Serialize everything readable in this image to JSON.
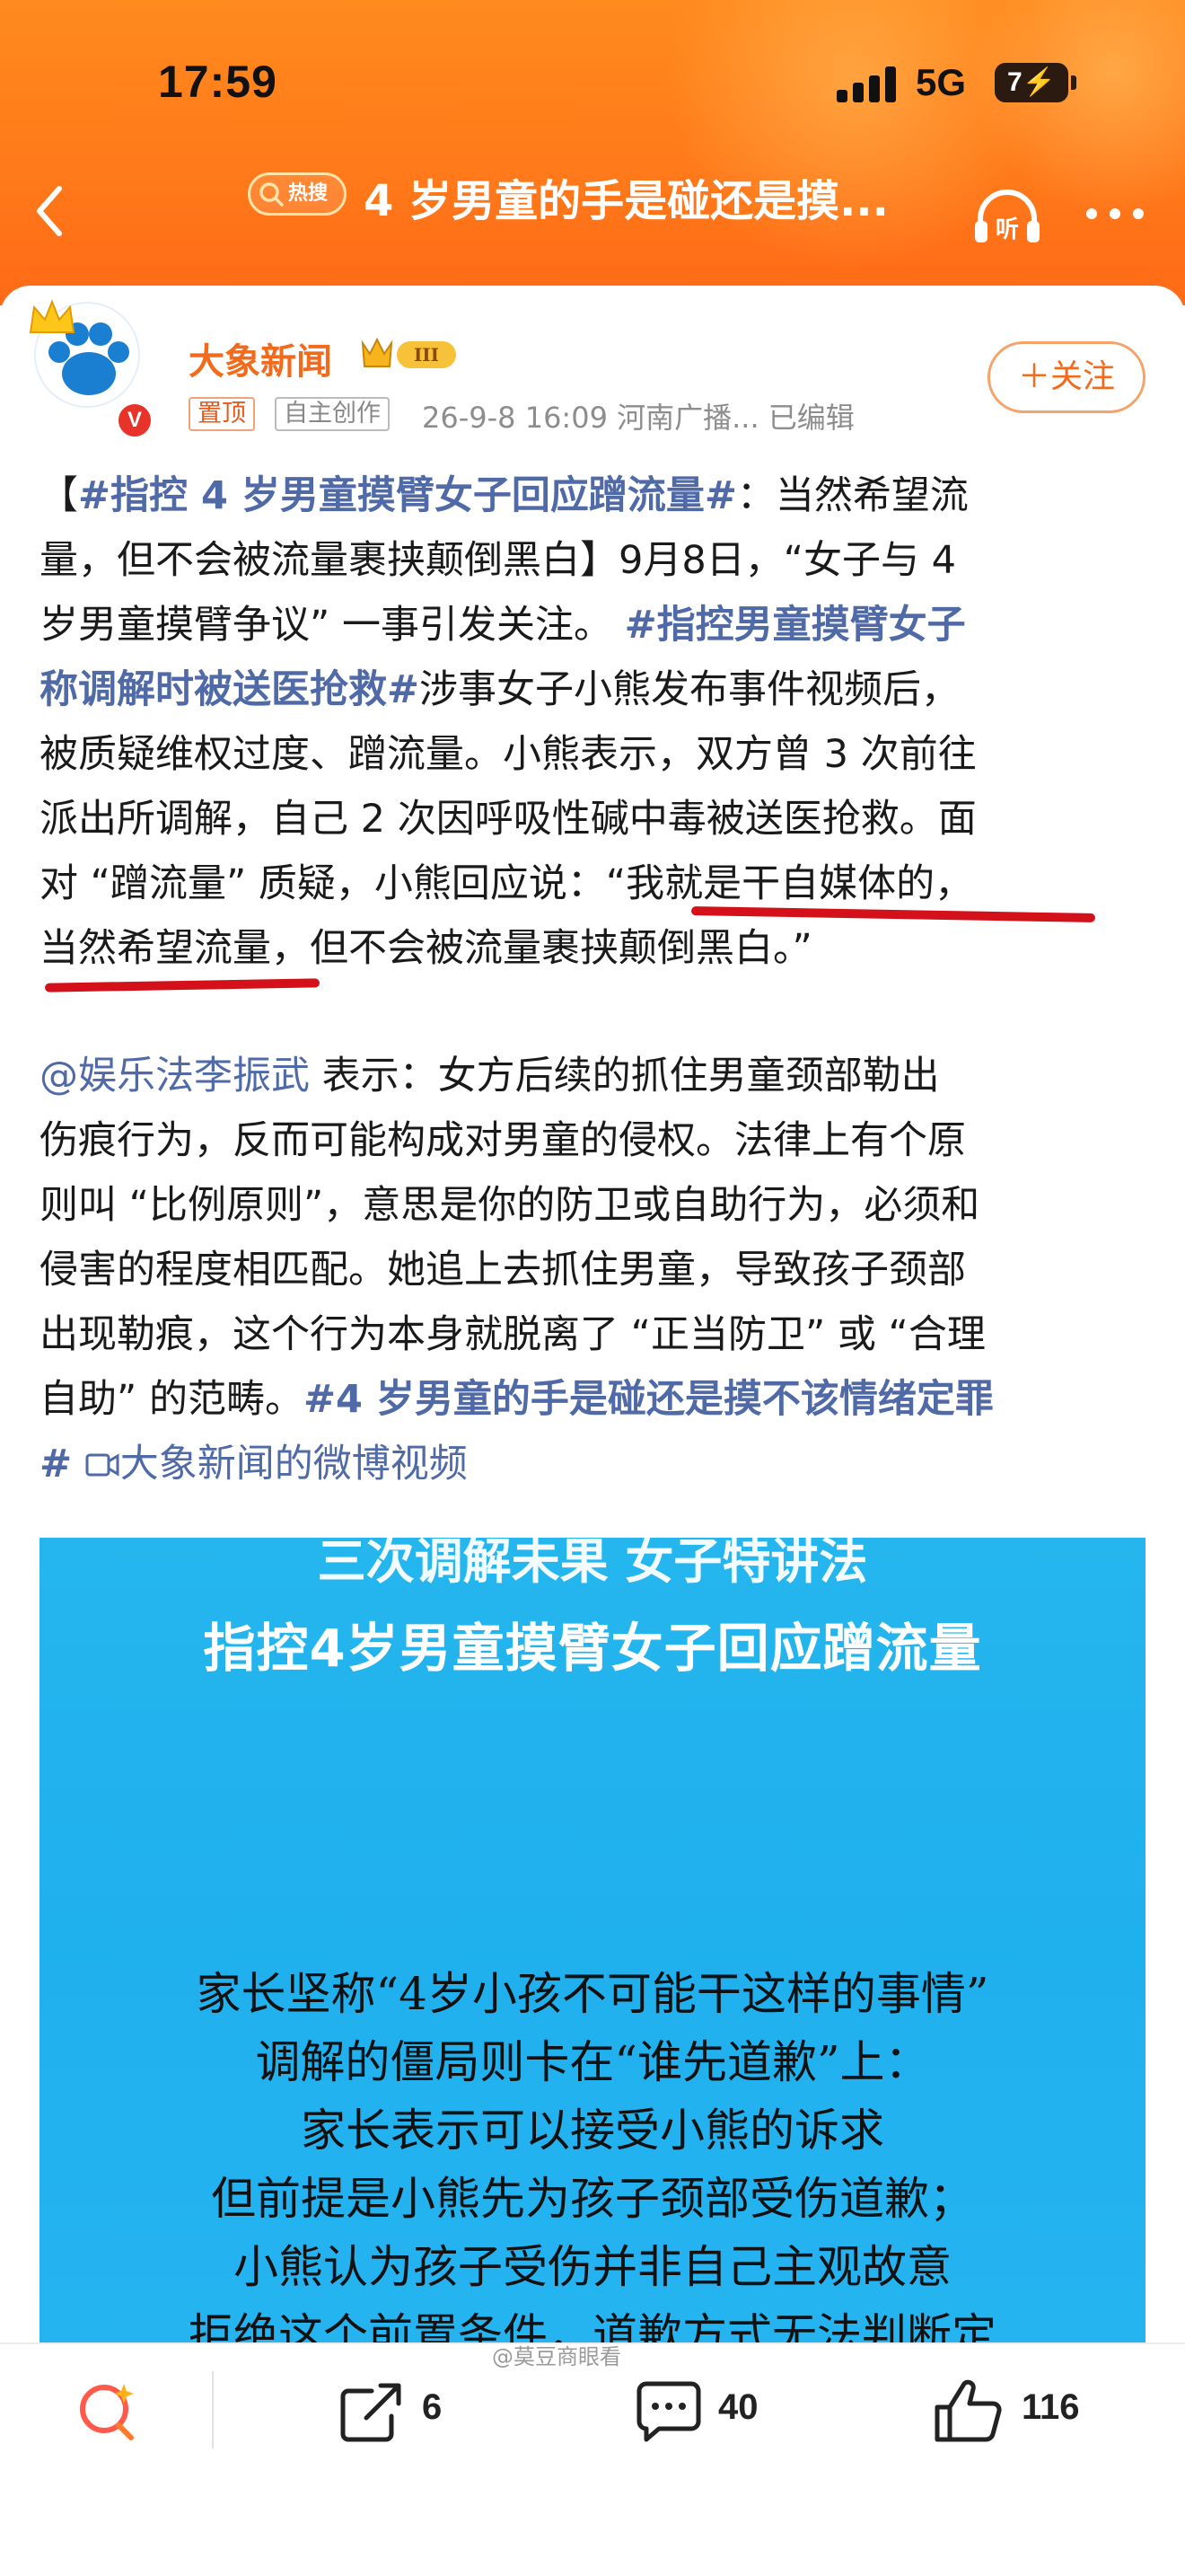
{
  "status_bar": {
    "time": "17:59",
    "network": "5G",
    "battery": "7"
  },
  "nav": {
    "hot_label": "热搜",
    "title": "4 岁男童的手是碰还是摸..."
  },
  "post": {
    "author": "大象新闻",
    "level": "III",
    "tag_pinned": "置顶",
    "tag_original": "自主创作",
    "meta": "26-9-8 16:09  河南广播...  已编辑",
    "follow_label": "＋关注",
    "p1": {
      "l1a": "【",
      "l1b": "#指控 4 岁男童摸臂女子回应蹭流量#",
      "l1c": "：当然希望流",
      "l2": "量，但不会被流量裹挟颠倒黑白】9月8日，“女子与 4",
      "l3a": "岁男童摸臂争议” 一事引发关注。 ",
      "l3b": "#指控男童摸臂女子",
      "l4a": "称调解时被送医抢救#",
      "l4b": "涉事女子小熊发布事件视频后，",
      "l5": "被质疑维权过度、蹭流量。小熊表示，双方曾 3 次前往",
      "l6": "派出所调解，自己 2 次因呼吸性碱中毒被送医抢救。面",
      "l7": "对 “蹭流量” 质疑，小熊回应说：“我就是干自媒体的，",
      "l8": "当然希望流量，但不会被流量裹挟颠倒黑白。”"
    },
    "p2": {
      "l1a": "@娱乐法李振武",
      "l1b": "  表示：女方后续的抓住男童颈部勒出",
      "l2": "伤痕行为，反而可能构成对男童的侵权。法律上有个原",
      "l3": "则叫 “比例原则”，意思是你的防卫或自助行为，必须和",
      "l4": "侵害的程度相匹配。她追上去抓住男童，导致孩子颈部",
      "l5": "出现勒痕，这个行为本身就脱离了 “正当防卫” 或 “合理",
      "l6a": "自助” 的范畴。",
      "l6b": "#4 岁男童的手是碰还是摸不该情绪定罪",
      "l7a": "#",
      "l7b": "大象新闻的微博视频"
    }
  },
  "video": {
    "cut_text": "三次调解未果 女子特讲法",
    "title": "指控4岁男童摸臂女子回应蹭流量",
    "captions": [
      "家长坚称“4岁小孩不可能干这样的事情”",
      "调解的僵局则卡在“谁先道歉”上：",
      "家长表示可以接受小熊的诉求",
      "但前提是小熊先为孩子颈部受伤道歉；",
      "小熊认为孩子受伤并非自己主观故意",
      "拒绝这个前置条件，道歉方式无法判断定"
    ]
  },
  "watermark": "@莫豆商眼看",
  "bottom_bar": {
    "share_count": "6",
    "comment_count": "40",
    "like_count": "116"
  },
  "colors": {
    "brand_orange": "#ff7a1a",
    "link_blue": "#4f6aa6",
    "underline_red": "#d4101a"
  }
}
